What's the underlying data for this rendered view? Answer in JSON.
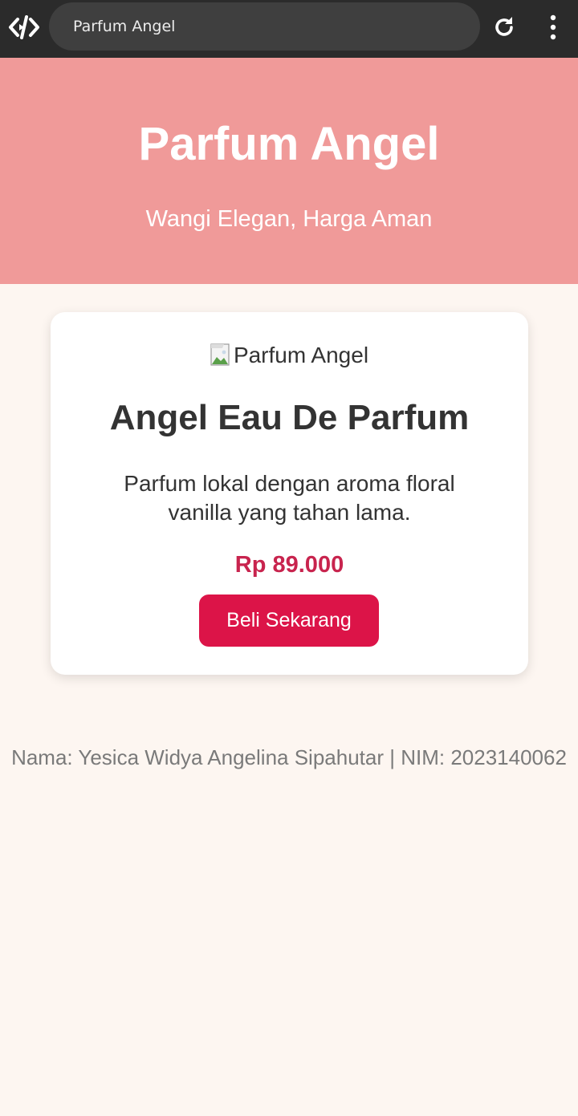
{
  "browser": {
    "tab_title": "Parfum Angel",
    "logo_icon": "code-brackets-icon",
    "reload_icon": "reload-icon",
    "menu_icon": "kebab-menu-icon"
  },
  "hero": {
    "title": "Parfum Angel",
    "tagline": "Wangi Elegan, Harga Aman",
    "background": "#f09a99"
  },
  "product": {
    "image_alt": "Parfum Angel",
    "name": "Angel Eau De Parfum",
    "description": "Parfum lokal dengan aroma floral vanilla yang tahan lama.",
    "price": "Rp 89.000",
    "buy_label": "Beli Sekarang",
    "accent": "#dc1448"
  },
  "footer": {
    "credit": "Nama: Yesica Widya Angelina Sipahutar | NIM: 2023140062"
  }
}
